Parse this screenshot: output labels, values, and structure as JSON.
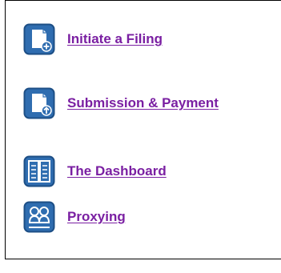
{
  "colors": {
    "link": "#7a1fa2",
    "icon_bg": "#2f6db0",
    "icon_border": "#1d4f86",
    "icon_fg": "#ffffff",
    "panel_border": "#000000"
  },
  "nav": {
    "items": [
      {
        "label": "Initiate a Filing",
        "icon": "new-document-icon"
      },
      {
        "label": "Submission & Payment",
        "icon": "upload-document-icon"
      },
      {
        "label": "The Dashboard",
        "icon": "dashboard-icon"
      },
      {
        "label": "Proxying",
        "icon": "proxy-users-icon"
      }
    ]
  }
}
